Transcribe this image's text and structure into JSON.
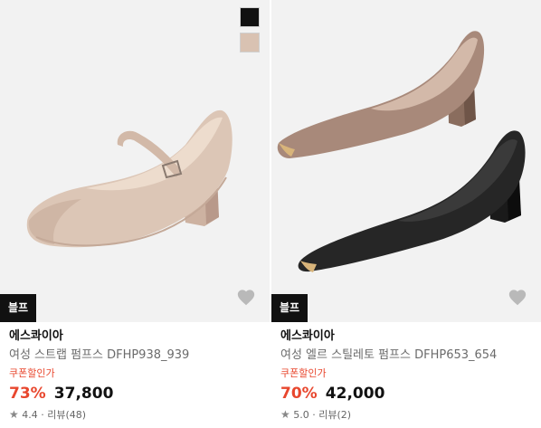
{
  "products": [
    {
      "badge": "블프",
      "brand": "에스콰이아",
      "name": "여성 스트랩 펌프스 DFHP938_939",
      "coupon": "쿠폰할인가",
      "discount": "73%",
      "price": "37,800",
      "rating": "4.4",
      "separator": "·",
      "reviews": "리뷰(48)",
      "swatches": [
        "#111111",
        "#d9c2b2"
      ],
      "heart_icon": "heart-icon",
      "star_icon": "star-icon"
    },
    {
      "badge": "블프",
      "brand": "에스콰이아",
      "name": "여성 엘르 스틸레토 펌프스 DFHP653_654",
      "coupon": "쿠폰할인가",
      "discount": "70%",
      "price": "42,000",
      "rating": "5.0",
      "separator": "·",
      "reviews": "리뷰(2)",
      "heart_icon": "heart-icon",
      "star_icon": "star-icon"
    }
  ],
  "colors": {
    "accent": "#e8472e",
    "badge_bg": "#111111",
    "image_bg": "#f2f2f2"
  }
}
